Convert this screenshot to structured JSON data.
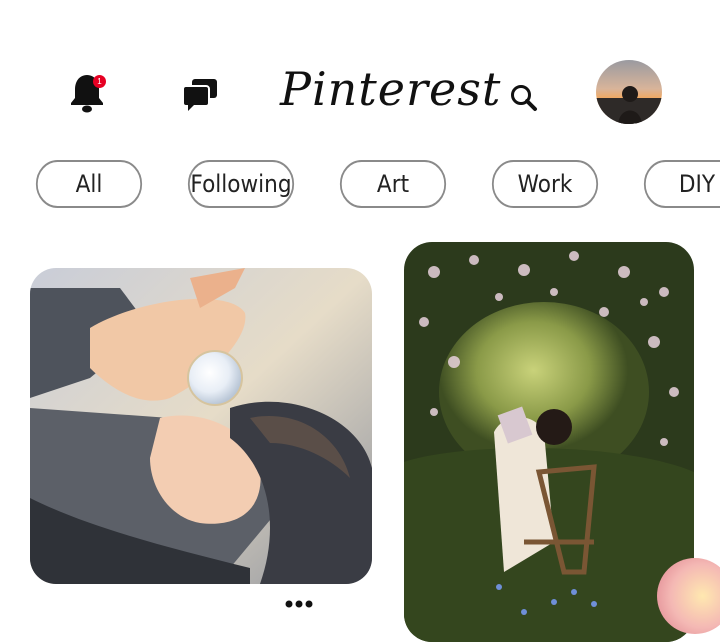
{
  "app": {
    "logo_text": "Pinterest",
    "notification_count": "1"
  },
  "header": {
    "icons": [
      "bell-icon",
      "chat-icon",
      "search-icon",
      "avatar"
    ]
  },
  "chips": [
    {
      "label": "All"
    },
    {
      "label": "Following"
    },
    {
      "label": "Art"
    },
    {
      "label": "Work"
    },
    {
      "label": "DIY"
    }
  ],
  "colors": {
    "badge": "#e60023",
    "chip_border": "#8a8a8a",
    "text": "#111111"
  }
}
